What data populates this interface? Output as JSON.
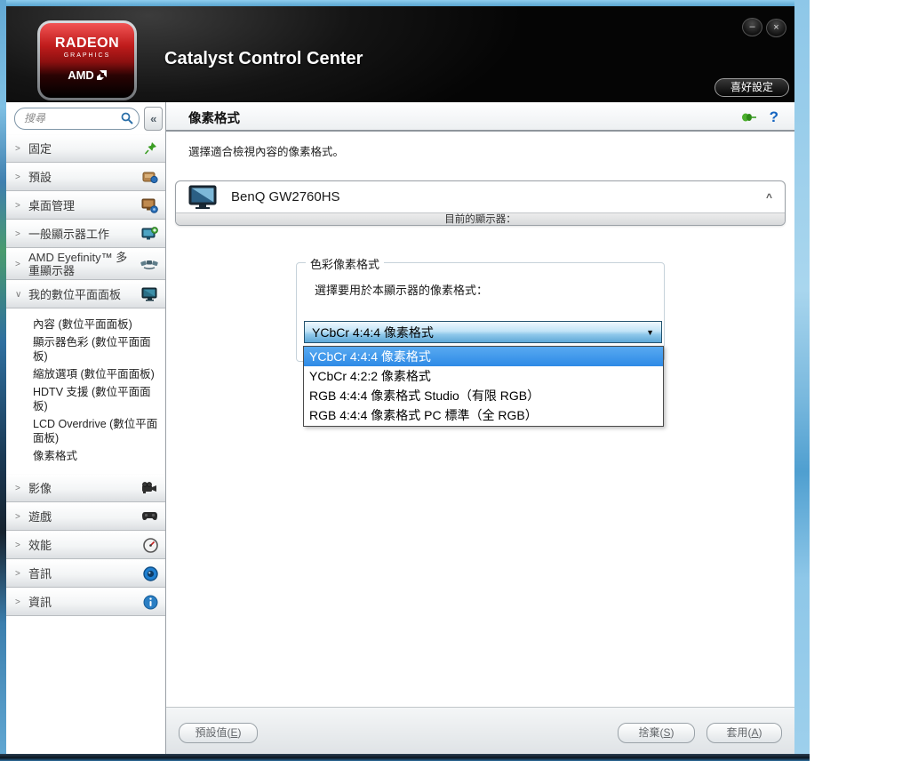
{
  "window": {
    "title": "Catalyst Control Center",
    "logo": {
      "radeon": "RADEON",
      "graphics": "GRAPHICS",
      "amd": "AMD"
    },
    "preferences_button": "喜好設定"
  },
  "icons": {
    "minimize": "–",
    "close": "×",
    "collapse_sidebar": "«",
    "chevron_collapsed": ">",
    "chevron_expanded": "∨",
    "panel_collapse_up": "^",
    "dropdown_arrow": "▼",
    "help": "?"
  },
  "sidebar": {
    "search": {
      "placeholder": "搜尋"
    },
    "groups": [
      {
        "label": "固定"
      },
      {
        "label": "預設"
      },
      {
        "label": "桌面管理"
      },
      {
        "label": "一般顯示器工作"
      },
      {
        "label": "AMD Eyefinity™ 多重顯示器"
      },
      {
        "label": "我的數位平面面板",
        "children": [
          "內容 (數位平面面板)",
          "顯示器色彩 (數位平面面板)",
          "縮放選項 (數位平面面板)",
          "HDTV 支援 (數位平面面板)",
          "LCD Overdrive (數位平面面板)",
          "像素格式"
        ]
      },
      {
        "label": "影像"
      },
      {
        "label": "遊戲"
      },
      {
        "label": "效能"
      },
      {
        "label": "音訊"
      },
      {
        "label": "資訊"
      }
    ]
  },
  "content": {
    "page_title": "像素格式",
    "description": "選擇適合檢視內容的像素格式。",
    "display_selector": {
      "name": "BenQ GW2760HS",
      "caption": "目前的顯示器："
    },
    "group_box": {
      "title": "色彩像素格式",
      "prompt": "選擇要用於本顯示器的像素格式：",
      "combobox": {
        "selected": "YCbCr 4:4:4 像素格式",
        "options": [
          "YCbCr 4:4:4 像素格式",
          "YCbCr 4:2:2 像素格式",
          "RGB 4:4:4 像素格式 Studio（有限 RGB）",
          "RGB 4:4:4 像素格式 PC 標準（全 RGB）"
        ]
      }
    },
    "buttons": {
      "defaults": {
        "prefix": "預設值(",
        "mnemonic": "E",
        "suffix": ")"
      },
      "discard": {
        "prefix": "捨棄(",
        "mnemonic": "S",
        "suffix": ")"
      },
      "apply": {
        "prefix": "套用(",
        "mnemonic": "A",
        "suffix": ")"
      }
    }
  },
  "colors": {
    "accent_blue": "#2e8ae6",
    "combo_gradient_bottom": "#5ea8d8",
    "titlebar_black": "#0a0a0a",
    "radeon_red": "#c01c1c",
    "frame_blue": "#8ec7e8"
  }
}
